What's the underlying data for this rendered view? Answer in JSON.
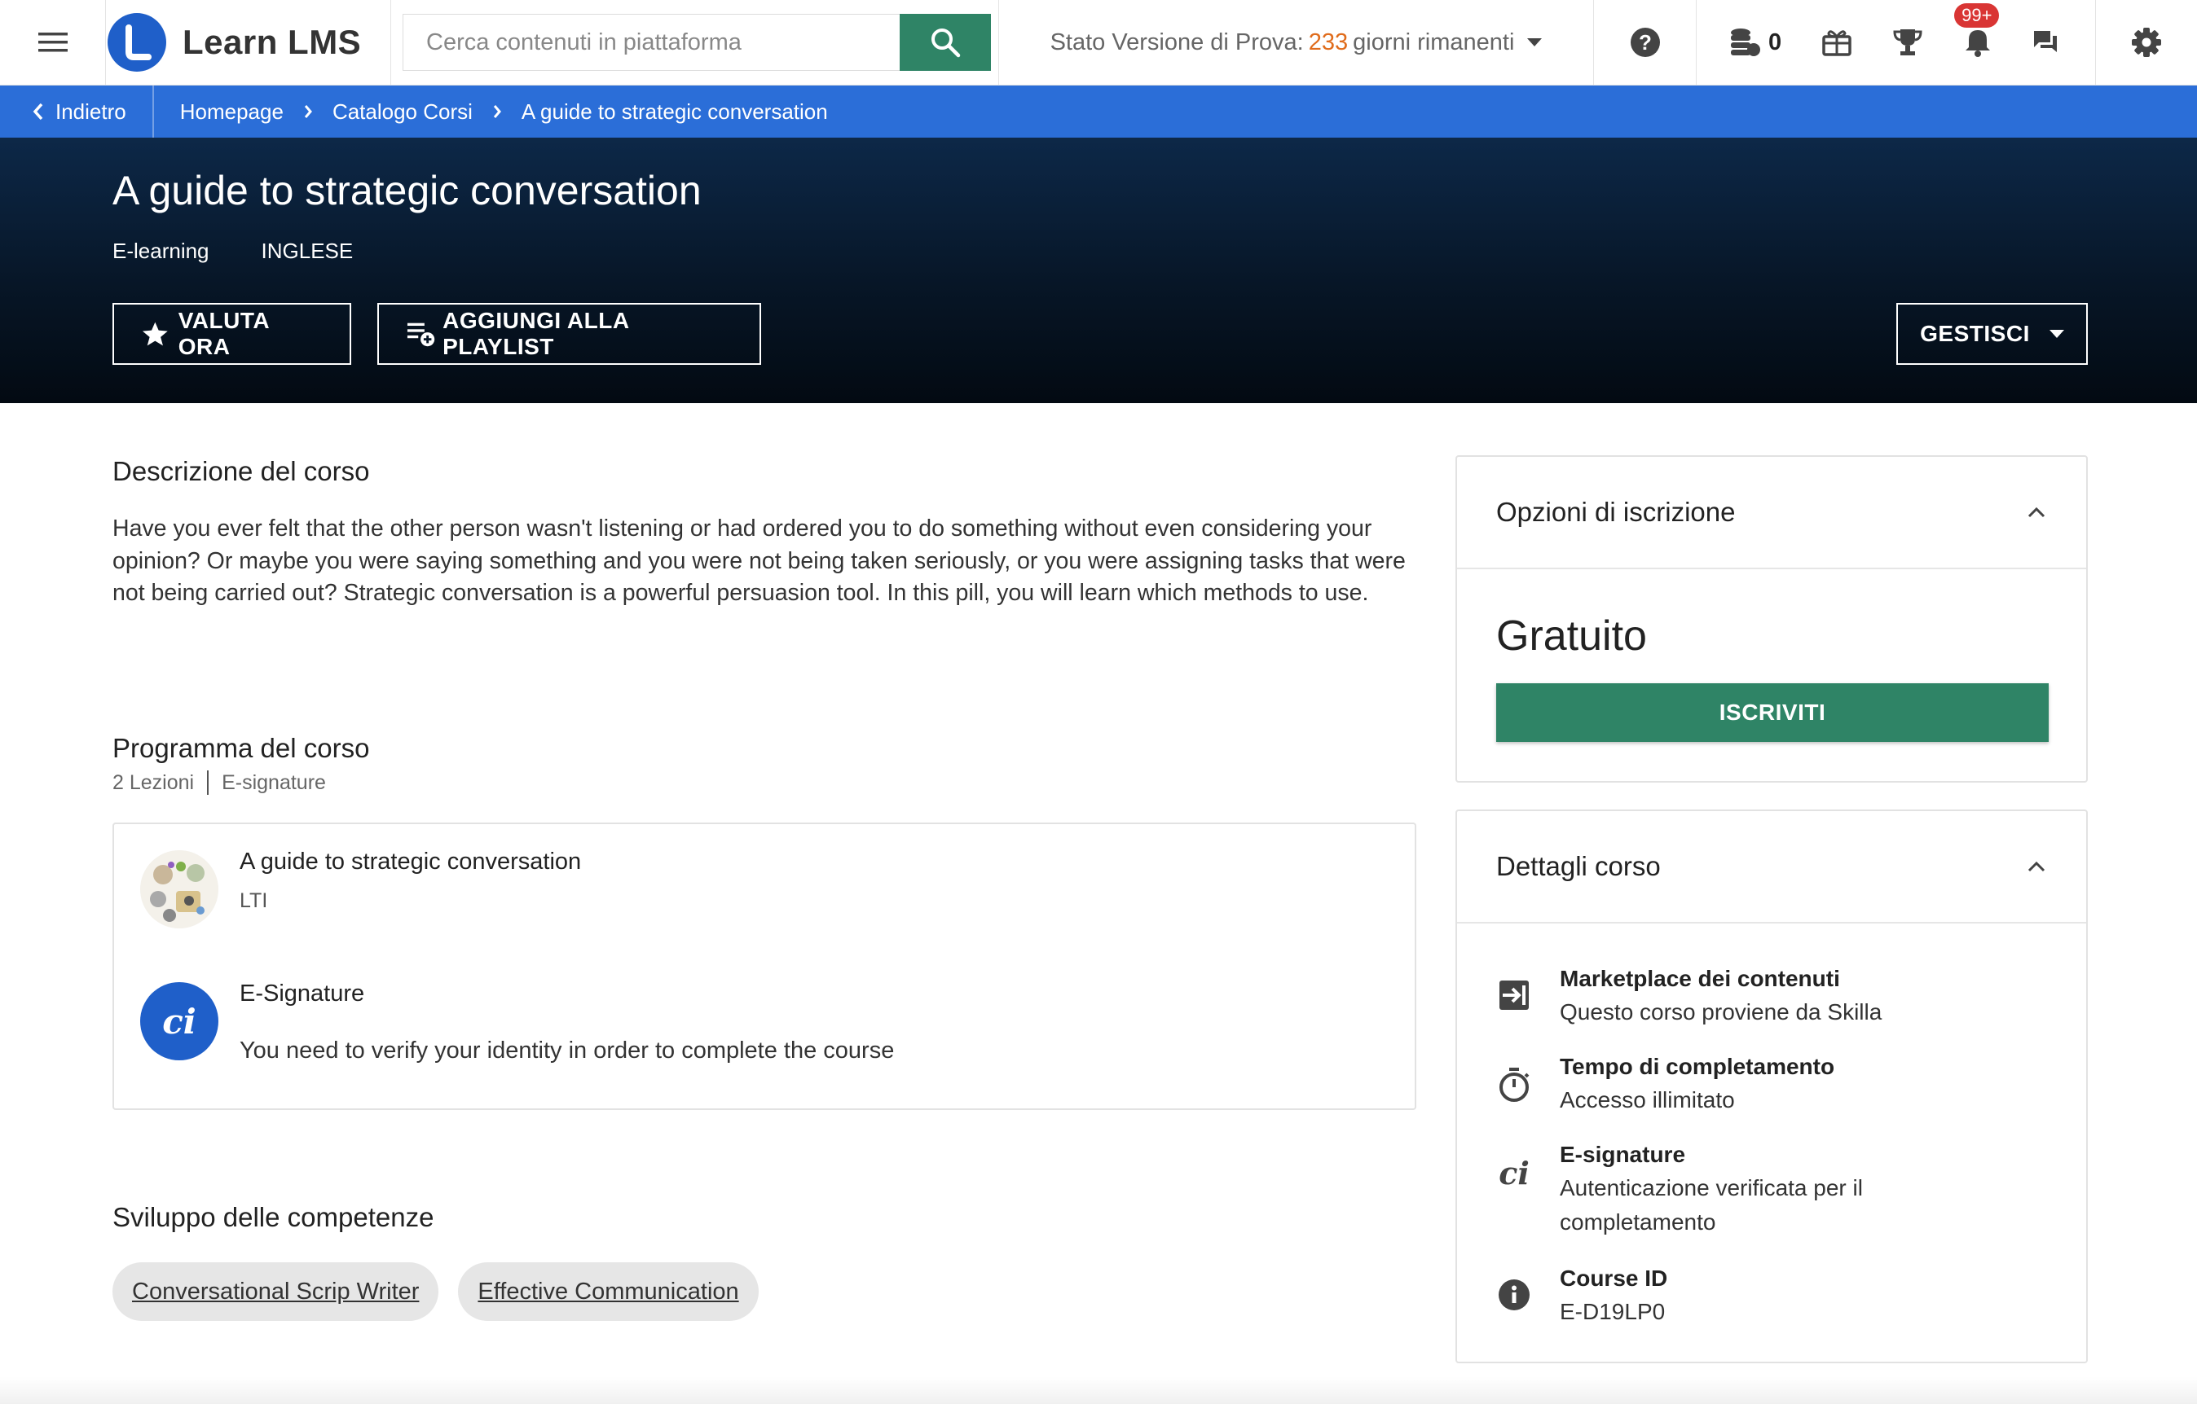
{
  "topbar": {
    "app_name": "Learn LMS",
    "search_placeholder": "Cerca contenuti in piattaforma",
    "trial_prefix": "Stato Versione di Prova:",
    "trial_days": "233",
    "trial_suffix": "giorni rimanenti",
    "coins_count": "0",
    "notifications_badge": "99+",
    "icons": [
      "menu-icon",
      "search-icon",
      "help-icon",
      "coins-icon",
      "gift-icon",
      "trophy-icon",
      "bell-icon",
      "chat-icon",
      "gear-icon"
    ]
  },
  "breadcrumb": {
    "back_label": "Indietro",
    "items": [
      "Homepage",
      "Catalogo Corsi",
      "A guide to strategic conversation"
    ]
  },
  "hero": {
    "title": "A guide to strategic conversation",
    "type": "E-learning",
    "language": "INGLESE",
    "rate_label": "VALUTA ORA",
    "playlist_label": "AGGIUNGI ALLA PLAYLIST",
    "manage_label": "GESTISCI"
  },
  "description": {
    "title": "Descrizione del corso",
    "text": "Have you ever felt that the other person wasn't listening or had ordered you to do something without even considering your opinion? Or maybe you were saying something and you were not being taken seriously, or you were assigning tasks that were not being carried out? Strategic conversation is a powerful persuasion tool. In this pill, you will learn which methods to use."
  },
  "program": {
    "title": "Programma del corso",
    "lessons_count": "2 Lezioni",
    "meta_esig": "E-signature",
    "lessons": [
      {
        "title": "A guide to strategic conversation",
        "subtitle": "LTI"
      },
      {
        "title": "E-Signature",
        "subtitle": "You need to verify your identity in order to complete the course"
      }
    ]
  },
  "skills": {
    "title": "Sviluppo delle competenze",
    "items": [
      "Conversational Scrip Writer",
      "Effective Communication"
    ]
  },
  "enrollment": {
    "title": "Opzioni di iscrizione",
    "price": "Gratuito",
    "enroll_label": "ISCRIVITI"
  },
  "details": {
    "title": "Dettagli corso",
    "items": [
      {
        "title": "Marketplace dei contenuti",
        "value": "Questo corso proviene da Skilla"
      },
      {
        "title": "Tempo di completamento",
        "value": "Accesso illimitato"
      },
      {
        "title": "E-signature",
        "value": "Autenticazione verificata per il completamento"
      },
      {
        "title": "Course ID",
        "value": "E-D19LP0"
      }
    ]
  },
  "colors": {
    "brand_blue": "#2b6ed8",
    "primary_green": "#2f8466",
    "trial_orange": "#e06c1c",
    "badge_red": "#d93534",
    "hero_dark": "#071627"
  }
}
